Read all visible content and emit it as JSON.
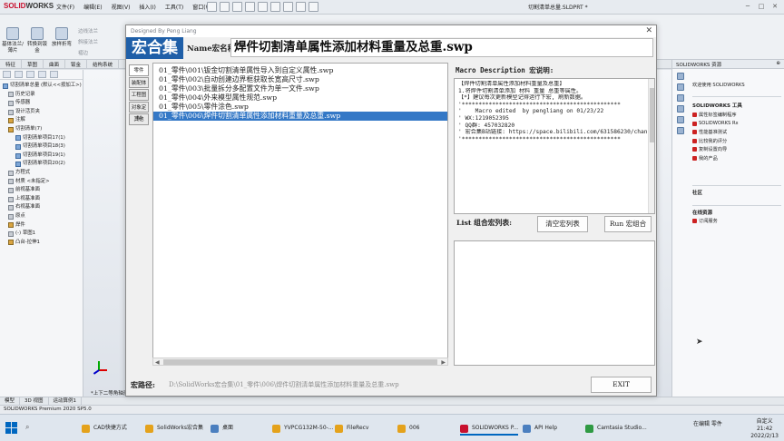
{
  "solidworks": {
    "logo_brand": "SOLID",
    "logo_rest": "WORKS",
    "menu": [
      "文件(F)",
      "编辑(E)",
      "视图(V)",
      "插入(I)",
      "工具(T)",
      "窗口(W)"
    ],
    "doc_title": "切割清单总量.SLDPRT *",
    "cmd_buttons": [
      "基体法兰/薄片",
      "转换到钣金",
      "放样折弯"
    ],
    "cmd_small": [
      "边线法兰",
      "斜接法兰",
      "褶边"
    ],
    "cmd_tabs": [
      "特征",
      "草图",
      "曲面",
      "钣金",
      "结构系统"
    ],
    "tree_items": [
      "切割清单总量 (默认<<按加工>)",
      "历史记录",
      "传感器",
      "设计活页夹",
      "注解",
      "切割清单(7)",
      "切割清单项目17(1)",
      "切割清单项目18(3)",
      "切割清单项目19(1)",
      "切割清单项目20(2)",
      "方程式",
      "材质 <未指定>",
      "前视基准面",
      "上视基准面",
      "右视基准面",
      "原点",
      "焊件",
      "(-) 草图1",
      "凸台-拉伸1"
    ],
    "view_label": "*上下二等角轴测",
    "bottom_tabs": [
      "模型",
      "3D 视图",
      "运动算例1"
    ],
    "status": "SOLIDWORKS Premium 2020 SP5.0",
    "taskpane": {
      "title": "SOLIDWORKS 资源",
      "welcome": "欢迎使用 SOLIDWORKS",
      "tools_title": "SOLIDWORKS 工具",
      "tools": [
        "属性标签编制程序",
        "SOLIDWORKS Rx",
        "性能基准测试",
        "比较我的评分",
        "复制设置向导",
        "我的产品"
      ],
      "community_title": "社区",
      "online_title": "在线资源",
      "online": [
        "订阅服务"
      ]
    }
  },
  "dialog": {
    "title": "Designed By Peng Liang",
    "brand": "宏合集",
    "name_label": "Name宏名称",
    "name_value": "焊件切割清单属性添加材料重量及总重.swp",
    "side_tabs": [
      "零件",
      "装配体",
      "工程图",
      "对象定制",
      "其他"
    ],
    "macros": [
      "01_零件\\001\\钣金切割清单属性导入到自定义属性.swp",
      "01_零件\\002\\自动创建边界框获取长宽高尺寸.swp",
      "01_零件\\003\\批量拆分多配置文件为单一文件.swp",
      "01_零件\\004\\外来模型属性规范.swp",
      "01_零件\\005\\零件涂色.swp",
      "01_零件\\006\\焊件切割清单属性添加材料重量及总重.swp"
    ],
    "selected_index": 5,
    "desc_label": "Macro Description 宏说明:",
    "desc_lines": [
      "【焊件切割清单属性添加材料重量及总重】",
      "1.将焊件切割清单添加 材料 重量 总重等属性。",
      "",
      "【*】建议每次更新模型记得运行下宏, 刷新数据。",
      "",
      "",
      "'***********************************************",
      "'    Macro edited  by pengliang on 01/23/22",
      "' WX:1219052395",
      "' QQ群: 457032820",
      "' 宏合集B站链接: https://space.bilibili.com/631586230/chann",
      "'***********************************************"
    ],
    "combo_label": "List 组合宏列表:",
    "clear_button": "清空宏列表",
    "run_button": "Run 宏组合",
    "path_label": "宏路径:",
    "path_value": "D:\\SolidWorks宏合集\\01_零件\\006\\焊件切割清单属性添加材料重量及总重.swp",
    "exit_button": "EXIT"
  },
  "taskbar": {
    "apps": [
      "CAD快捷方式",
      "SolidWorks宏合集",
      "桌面",
      "YVPCG132M-50-...",
      "FileRecv",
      "006",
      "SOLIDWORKS P...",
      "API Help",
      "Camtasia Studio..."
    ],
    "tray_text": "在编辑 零件",
    "custom": "自定义",
    "time": "21:42",
    "date": "2022/2/13"
  }
}
